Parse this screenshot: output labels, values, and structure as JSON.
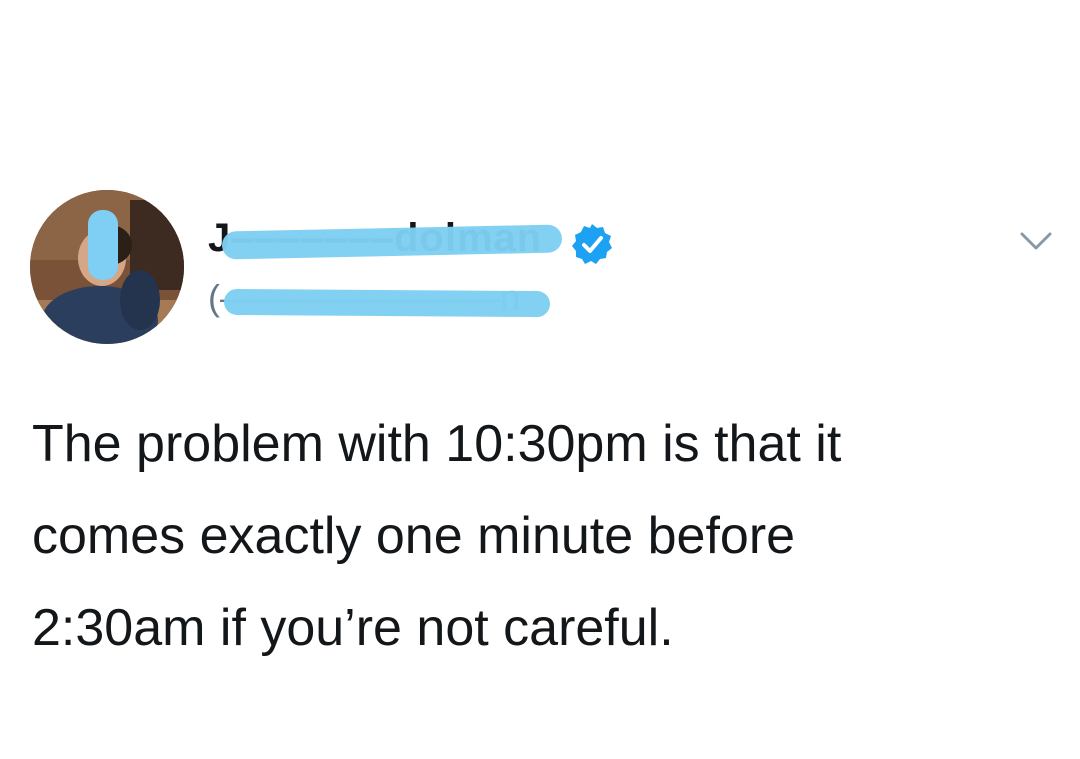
{
  "tweet": {
    "author": {
      "display_name": "J‒‒‒‒‒‒‒dolman",
      "handle": "(‒‒‒‒‒‒‒‒‒‒‒‒‒‒n",
      "verified": true
    },
    "text_lines": [
      "The problem with 10:30pm is that it",
      "comes exactly one minute before",
      "2:30am if you’re not careful."
    ],
    "menu_icon": "chevron-down-icon",
    "verified_icon": "verified-badge-icon",
    "colors": {
      "verified_badge": "#1da1f2",
      "redaction": "#7ecff3",
      "text": "#14171a",
      "muted": "#657786"
    }
  }
}
